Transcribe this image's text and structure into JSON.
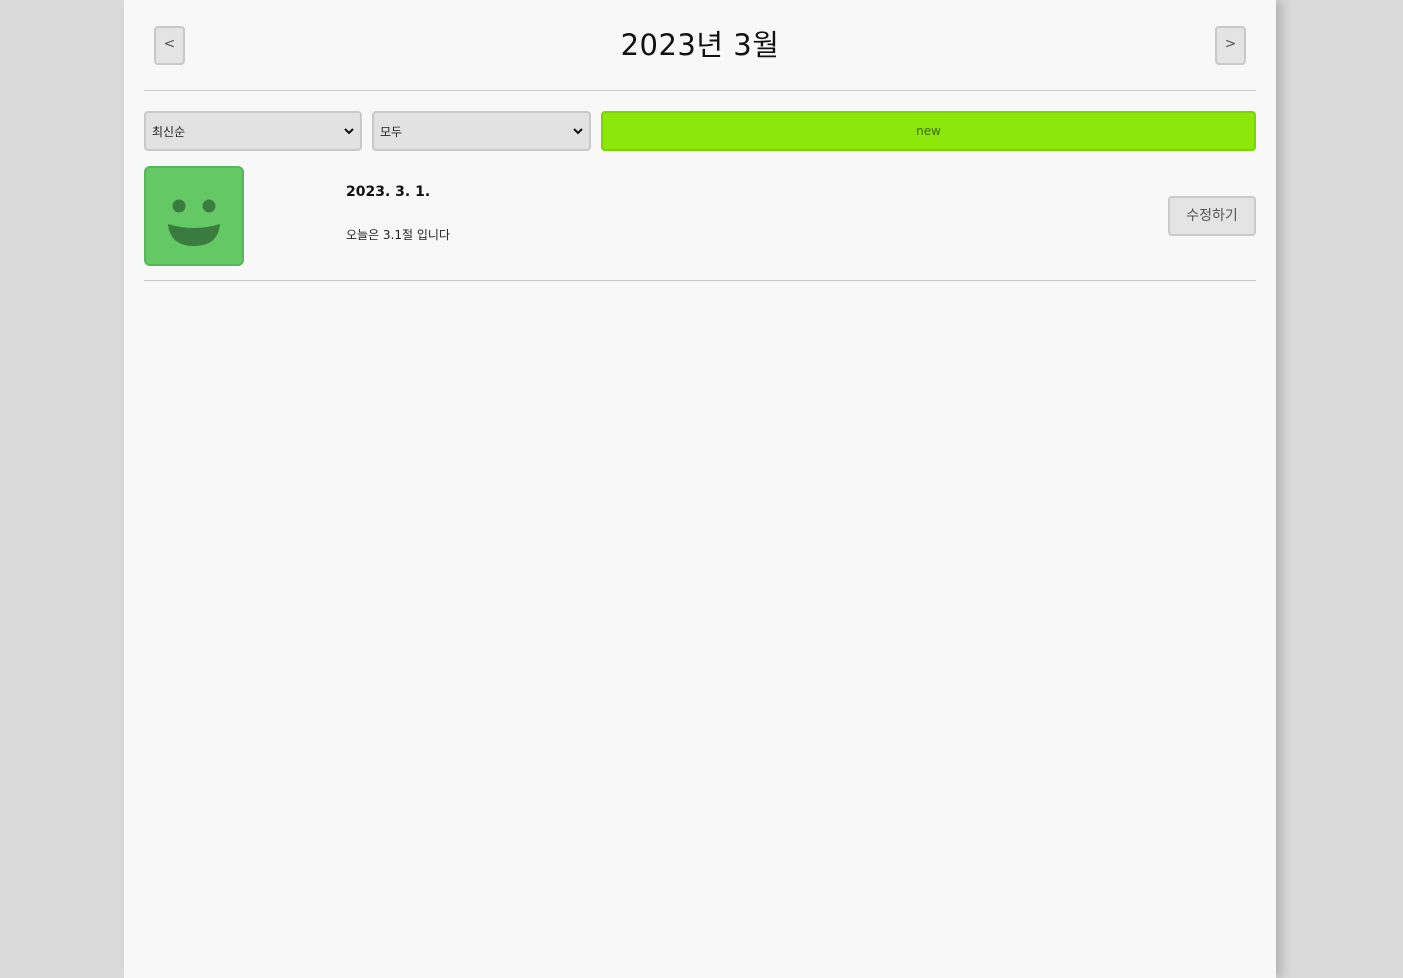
{
  "header": {
    "title": "2023년 3월",
    "prev_label": "<",
    "next_label": ">"
  },
  "controls": {
    "sort_selected": "최신순",
    "filter_selected": "모두",
    "new_label": "new"
  },
  "diary_list": [
    {
      "emotion_icon": "smile-face-icon",
      "emotion_color": "#64c964",
      "date": "2023. 3. 1.",
      "content": "오늘은 3.1절 입니다",
      "edit_label": "수정하기"
    }
  ],
  "colors": {
    "new_button": "#8ce80a",
    "emotion_good": "#64c964",
    "background": "#f8f8f8"
  }
}
